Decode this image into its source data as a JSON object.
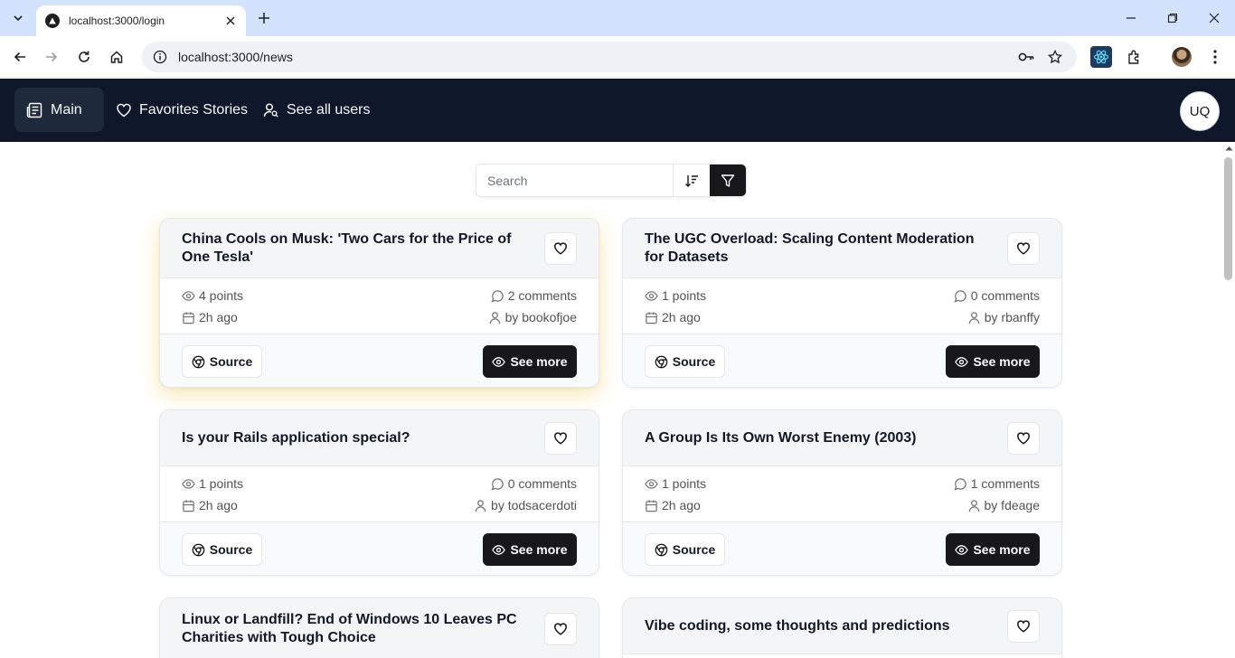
{
  "browser": {
    "tab_title": "localhost:3000/login",
    "url": "localhost:3000/news",
    "profile_icon": "profile-avatar-icon"
  },
  "nav": {
    "items": [
      {
        "label": "Main",
        "icon": "newspaper-icon"
      },
      {
        "label": "Favorites Stories",
        "icon": "heart-icon"
      },
      {
        "label": "See all users",
        "icon": "user-search-icon"
      }
    ],
    "avatar_initials": "UQ"
  },
  "search": {
    "placeholder": "Search",
    "value": ""
  },
  "colors": {
    "header_bg": "#0f172a",
    "primary_button": "#18181b",
    "highlight_glow": "#eab308"
  },
  "stories": [
    {
      "title": "China Cools on Musk: 'Two Cars for the Price of One Tesla'",
      "points": "4 points",
      "comments": "2 comments",
      "time": "2h ago",
      "author": "by bookofjoe",
      "source_label": "Source",
      "see_more_label": "See more"
    },
    {
      "title": "The UGC Overload: Scaling Content Moderation for Datasets",
      "points": "1 points",
      "comments": "0 comments",
      "time": "2h ago",
      "author": "by rbanffy",
      "source_label": "Source",
      "see_more_label": "See more"
    },
    {
      "title": "Is your Rails application special?",
      "points": "1 points",
      "comments": "0 comments",
      "time": "2h ago",
      "author": "by todsacerdoti",
      "source_label": "Source",
      "see_more_label": "See more"
    },
    {
      "title": "A Group Is Its Own Worst Enemy (2003)",
      "points": "1 points",
      "comments": "1 comments",
      "time": "2h ago",
      "author": "by fdeage",
      "source_label": "Source",
      "see_more_label": "See more"
    },
    {
      "title": "Linux or Landfill? End of Windows 10 Leaves PC Charities with Tough Choice"
    },
    {
      "title": "Vibe coding, some thoughts and predictions"
    }
  ]
}
